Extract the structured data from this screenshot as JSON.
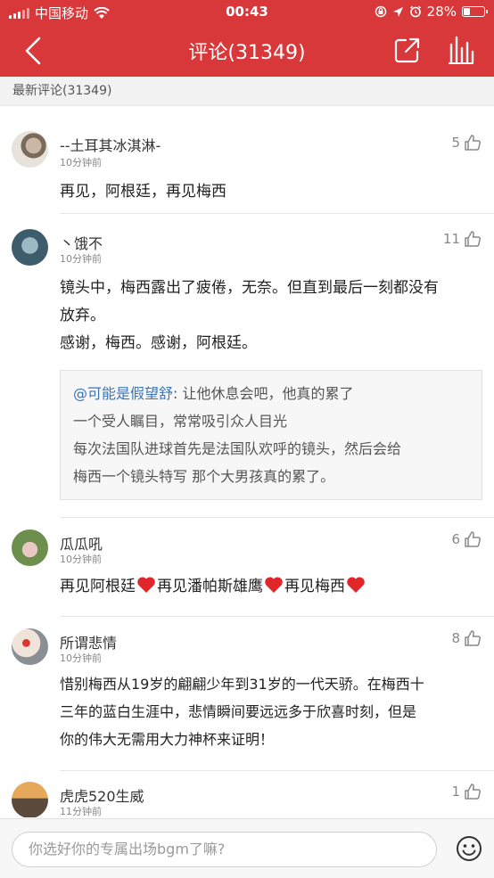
{
  "status_bar": {
    "carrier": "中国移动",
    "time": "00:43",
    "battery": "28%"
  },
  "nav": {
    "title": "评论(31349)"
  },
  "section": {
    "label": "最新评论(31349)"
  },
  "comments": [
    {
      "name": "--土耳其冰淇淋-",
      "time": "10分钟前",
      "likes": "5",
      "lines": [
        "再见，阿根廷，再见梅西"
      ]
    },
    {
      "name": "丶饿不",
      "time": "10分钟前",
      "likes": "11",
      "lines": [
        "镜头中，梅西露出了疲倦，无奈。但直到最后一刻都没有",
        "放弃。",
        "感谢，梅西。感谢，阿根廷。"
      ],
      "quote": {
        "name": "@可能是假望舒",
        "text_first": ": 让他休息会吧，他真的累了",
        "lines": [
          "一个受人瞩目，常常吸引众人目光",
          "每次法国队进球首先是法国队欢呼的镜头，然后会给",
          "梅西一个镜头特写 那个大男孩真的累了。"
        ]
      }
    },
    {
      "name": "瓜瓜吼",
      "time": "10分钟前",
      "likes": "6",
      "segments": [
        "再见阿根廷",
        "再见潘帕斯雄鹰",
        "再见梅西"
      ]
    },
    {
      "name": "所谓悲情",
      "time": "10分钟前",
      "likes": "8",
      "lines": [
        "惜别梅西从19岁的翩翩少年到31岁的一代天骄。在梅西十",
        "三年的蓝白生涯中，悲情瞬间要远远多于欣喜时刻，但是",
        "你的伟大无需用大力神杯来证明！"
      ]
    },
    {
      "name": "虎虎520生威",
      "time": "11分钟前",
      "likes": "1"
    }
  ],
  "input": {
    "placeholder": "你选好你的专属出场bgm了嘛?"
  },
  "colors": {
    "brand": "#d9383a",
    "mention": "#3b73b9",
    "heart": "#e0262b"
  }
}
